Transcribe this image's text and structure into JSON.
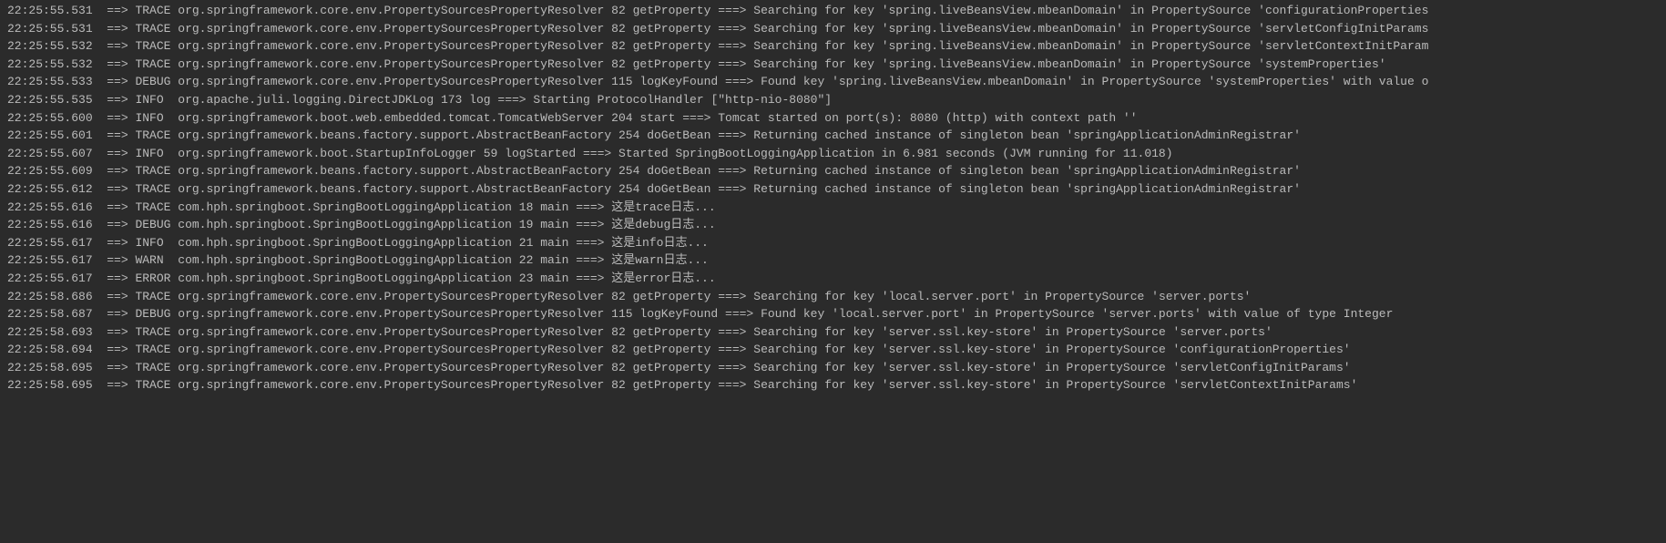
{
  "logs": [
    {
      "time": "22:25:55.531",
      "arrow": "==>",
      "level": "TRACE",
      "logger": "org.springframework.core.env.PropertySourcesPropertyResolver",
      "lineno": "82",
      "method": "getProperty",
      "sep": "===>",
      "message": "Searching for key 'spring.liveBeansView.mbeanDomain' in PropertySource 'configurationProperties"
    },
    {
      "time": "22:25:55.531",
      "arrow": "==>",
      "level": "TRACE",
      "logger": "org.springframework.core.env.PropertySourcesPropertyResolver",
      "lineno": "82",
      "method": "getProperty",
      "sep": "===>",
      "message": "Searching for key 'spring.liveBeansView.mbeanDomain' in PropertySource 'servletConfigInitParams"
    },
    {
      "time": "22:25:55.532",
      "arrow": "==>",
      "level": "TRACE",
      "logger": "org.springframework.core.env.PropertySourcesPropertyResolver",
      "lineno": "82",
      "method": "getProperty",
      "sep": "===>",
      "message": "Searching for key 'spring.liveBeansView.mbeanDomain' in PropertySource 'servletContextInitParam"
    },
    {
      "time": "22:25:55.532",
      "arrow": "==>",
      "level": "TRACE",
      "logger": "org.springframework.core.env.PropertySourcesPropertyResolver",
      "lineno": "82",
      "method": "getProperty",
      "sep": "===>",
      "message": "Searching for key 'spring.liveBeansView.mbeanDomain' in PropertySource 'systemProperties'"
    },
    {
      "time": "22:25:55.533",
      "arrow": "==>",
      "level": "DEBUG",
      "logger": "org.springframework.core.env.PropertySourcesPropertyResolver",
      "lineno": "115",
      "method": "logKeyFound",
      "sep": "===>",
      "message": "Found key 'spring.liveBeansView.mbeanDomain' in PropertySource 'systemProperties' with value o"
    },
    {
      "time": "22:25:55.535",
      "arrow": "==>",
      "level": "INFO ",
      "logger": "org.apache.juli.logging.DirectJDKLog",
      "lineno": "173",
      "method": "log",
      "sep": "===>",
      "message": "Starting ProtocolHandler [\"http-nio-8080\"]"
    },
    {
      "time": "22:25:55.600",
      "arrow": "==>",
      "level": "INFO ",
      "logger": "org.springframework.boot.web.embedded.tomcat.TomcatWebServer",
      "lineno": "204",
      "method": "start",
      "sep": "===>",
      "message": "Tomcat started on port(s): 8080 (http) with context path ''"
    },
    {
      "time": "22:25:55.601",
      "arrow": "==>",
      "level": "TRACE",
      "logger": "org.springframework.beans.factory.support.AbstractBeanFactory",
      "lineno": "254",
      "method": "doGetBean",
      "sep": "===>",
      "message": "Returning cached instance of singleton bean 'springApplicationAdminRegistrar'"
    },
    {
      "time": "22:25:55.607",
      "arrow": "==>",
      "level": "INFO ",
      "logger": "org.springframework.boot.StartupInfoLogger",
      "lineno": "59",
      "method": "logStarted",
      "sep": "===>",
      "message": "Started SpringBootLoggingApplication in 6.981 seconds (JVM running for 11.018)"
    },
    {
      "time": "22:25:55.609",
      "arrow": "==>",
      "level": "TRACE",
      "logger": "org.springframework.beans.factory.support.AbstractBeanFactory",
      "lineno": "254",
      "method": "doGetBean",
      "sep": "===>",
      "message": "Returning cached instance of singleton bean 'springApplicationAdminRegistrar'"
    },
    {
      "time": "22:25:55.612",
      "arrow": "==>",
      "level": "TRACE",
      "logger": "org.springframework.beans.factory.support.AbstractBeanFactory",
      "lineno": "254",
      "method": "doGetBean",
      "sep": "===>",
      "message": "Returning cached instance of singleton bean 'springApplicationAdminRegistrar'"
    },
    {
      "time": "22:25:55.616",
      "arrow": "==>",
      "level": "TRACE",
      "logger": "com.hph.springboot.SpringBootLoggingApplication",
      "lineno": "18",
      "method": "main",
      "sep": "===>",
      "message": "这是trace日志..."
    },
    {
      "time": "22:25:55.616",
      "arrow": "==>",
      "level": "DEBUG",
      "logger": "com.hph.springboot.SpringBootLoggingApplication",
      "lineno": "19",
      "method": "main",
      "sep": "===>",
      "message": "这是debug日志..."
    },
    {
      "time": "22:25:55.617",
      "arrow": "==>",
      "level": "INFO ",
      "logger": "com.hph.springboot.SpringBootLoggingApplication",
      "lineno": "21",
      "method": "main",
      "sep": "===>",
      "message": "这是info日志..."
    },
    {
      "time": "22:25:55.617",
      "arrow": "==>",
      "level": "WARN ",
      "logger": "com.hph.springboot.SpringBootLoggingApplication",
      "lineno": "22",
      "method": "main",
      "sep": "===>",
      "message": "这是warn日志..."
    },
    {
      "time": "22:25:55.617",
      "arrow": "==>",
      "level": "ERROR",
      "logger": "com.hph.springboot.SpringBootLoggingApplication",
      "lineno": "23",
      "method": "main",
      "sep": "===>",
      "message": "这是error日志..."
    },
    {
      "time": "22:25:58.686",
      "arrow": "==>",
      "level": "TRACE",
      "logger": "org.springframework.core.env.PropertySourcesPropertyResolver",
      "lineno": "82",
      "method": "getProperty",
      "sep": "===>",
      "message": "Searching for key 'local.server.port' in PropertySource 'server.ports'"
    },
    {
      "time": "22:25:58.687",
      "arrow": "==>",
      "level": "DEBUG",
      "logger": "org.springframework.core.env.PropertySourcesPropertyResolver",
      "lineno": "115",
      "method": "logKeyFound",
      "sep": "===>",
      "message": "Found key 'local.server.port' in PropertySource 'server.ports' with value of type Integer"
    },
    {
      "time": "22:25:58.693",
      "arrow": "==>",
      "level": "TRACE",
      "logger": "org.springframework.core.env.PropertySourcesPropertyResolver",
      "lineno": "82",
      "method": "getProperty",
      "sep": "===>",
      "message": "Searching for key 'server.ssl.key-store' in PropertySource 'server.ports'"
    },
    {
      "time": "22:25:58.694",
      "arrow": "==>",
      "level": "TRACE",
      "logger": "org.springframework.core.env.PropertySourcesPropertyResolver",
      "lineno": "82",
      "method": "getProperty",
      "sep": "===>",
      "message": "Searching for key 'server.ssl.key-store' in PropertySource 'configurationProperties'"
    },
    {
      "time": "22:25:58.695",
      "arrow": "==>",
      "level": "TRACE",
      "logger": "org.springframework.core.env.PropertySourcesPropertyResolver",
      "lineno": "82",
      "method": "getProperty",
      "sep": "===>",
      "message": "Searching for key 'server.ssl.key-store' in PropertySource 'servletConfigInitParams'"
    },
    {
      "time": "22:25:58.695",
      "arrow": "==>",
      "level": "TRACE",
      "logger": "org.springframework.core.env.PropertySourcesPropertyResolver",
      "lineno": "82",
      "method": "getProperty",
      "sep": "===>",
      "message": "Searching for key 'server.ssl.key-store' in PropertySource 'servletContextInitParams'"
    }
  ]
}
